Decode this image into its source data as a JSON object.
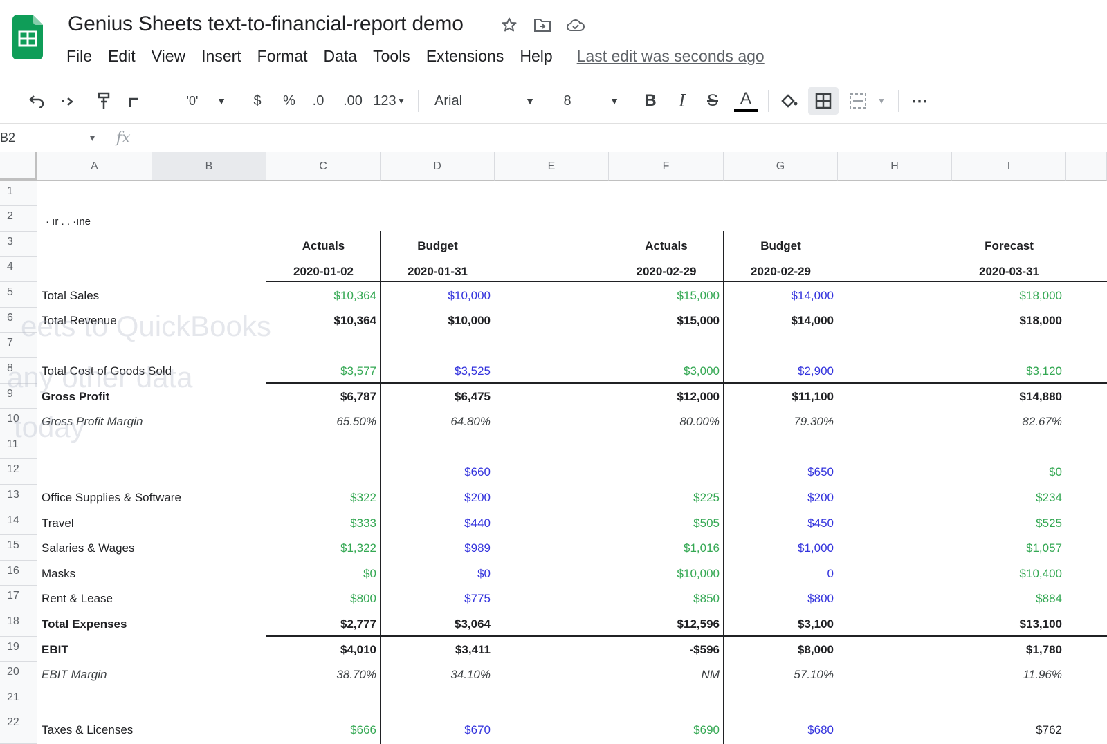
{
  "app": {
    "doc_title": "Genius Sheets text-to-financial-report demo",
    "menu": [
      "File",
      "Edit",
      "View",
      "Insert",
      "Format",
      "Data",
      "Tools",
      "Extensions",
      "Help"
    ],
    "last_edit": "Last edit was seconds ago",
    "icons": [
      "star-icon",
      "move-to-folder-icon",
      "cloud-status-icon"
    ],
    "brand_color": "#0f9d58"
  },
  "toolbar": {
    "zoom": "'0'",
    "currency": "$",
    "percent": "%",
    "dec_less": ".0",
    "dec_more": ".00",
    "more_formats": "123",
    "font": "Arial",
    "font_size": "8",
    "bold": "B",
    "italic": "I",
    "strike": "S",
    "text_color": "A",
    "more": "⋯"
  },
  "formula_bar": {
    "name_box": "B2",
    "fx": "fx"
  },
  "columns": [
    "A",
    "B",
    "C",
    "D",
    "E",
    "F",
    "G",
    "H",
    "I"
  ],
  "rows": [
    "1",
    "2",
    "3",
    "4",
    "5",
    "6",
    "7",
    "8",
    "9",
    "10",
    "11",
    "12",
    "13",
    "14",
    "15",
    "16",
    "17",
    "18",
    "19",
    "20",
    "21",
    "22"
  ],
  "header": {
    "fragment": "·  ır  .  .  ·ıne",
    "c": {
      "type": "Actuals",
      "date": "2020-01-02"
    },
    "d": {
      "type": "Budget",
      "date": "2020-01-31"
    },
    "f": {
      "type": "Actuals",
      "date": "2020-02-29"
    },
    "g": {
      "type": "Budget",
      "date": "2020-02-29"
    },
    "i": {
      "type": "Forecast",
      "date": "2020-03-31"
    }
  },
  "report": {
    "r5": {
      "label": "Total Sales",
      "c": "$10,364",
      "d": "$10,000",
      "f": "$15,000",
      "g": "$14,000",
      "i": "$18,000"
    },
    "r6": {
      "label": "Total Revenue",
      "c": "$10,364",
      "d": "$10,000",
      "f": "$15,000",
      "g": "$14,000",
      "i": "$18,000"
    },
    "r8": {
      "label": "Total Cost of Goods Sold",
      "c": "$3,577",
      "d": "$3,525",
      "f": "$3,000",
      "g": "$2,900",
      "i": "$3,120"
    },
    "r9": {
      "label": "Gross Profit",
      "c": "$6,787",
      "d": "$6,475",
      "f": "$12,000",
      "g": "$11,100",
      "i": "$14,880"
    },
    "r10": {
      "label": "Gross Profit Margin",
      "c": "65.50%",
      "d": "64.80%",
      "f": "80.00%",
      "g": "79.30%",
      "i": "82.67%"
    },
    "r12": {
      "label": "",
      "c": "",
      "d": "$660",
      "f": "",
      "g": "$650",
      "i": "$0"
    },
    "r13": {
      "label": "Office Supplies & Software",
      "c": "$322",
      "d": "$200",
      "f": "$225",
      "g": "$200",
      "i": "$234"
    },
    "r14": {
      "label": "Travel",
      "c": "$333",
      "d": "$440",
      "f": "$505",
      "g": "$450",
      "i": "$525"
    },
    "r15": {
      "label": "Salaries & Wages",
      "c": "$1,322",
      "d": "$989",
      "f": "$1,016",
      "g": "$1,000",
      "i": "$1,057"
    },
    "r16": {
      "label": "Masks",
      "c": "$0",
      "d": "$0",
      "f": "$10,000",
      "g": "0",
      "i": "$10,400"
    },
    "r17": {
      "label": "Rent & Lease",
      "c": "$800",
      "d": "$775",
      "f": "$850",
      "g": "$800",
      "i": "$884"
    },
    "r18": {
      "label": "Total Expenses",
      "c": "$2,777",
      "d": "$3,064",
      "f": "$12,596",
      "g": "$3,100",
      "i": "$13,100"
    },
    "r19": {
      "label": "EBIT",
      "c": "$4,010",
      "d": "$3,411",
      "f": "-$596",
      "g": "$8,000",
      "i": "$1,780"
    },
    "r20": {
      "label": "EBIT Margin",
      "c": "38.70%",
      "d": "34.10%",
      "f": "NM",
      "g": "57.10%",
      "i": "11.96%"
    },
    "r22": {
      "label": "Taxes & Licenses",
      "c": "$666",
      "d": "$670",
      "f": "$690",
      "g": "$680",
      "i": "$762"
    }
  },
  "overlay_text": [
    "eets to QuickBooks",
    "any other data",
    "today"
  ],
  "colors": {
    "actuals": "#34a853",
    "budget": "#3333dd",
    "forecast": "#34a853"
  }
}
